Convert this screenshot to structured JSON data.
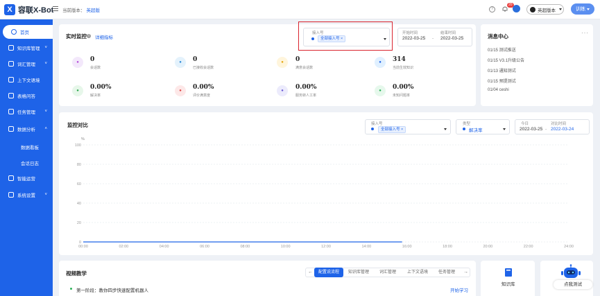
{
  "brand": {
    "name": "容联X-Bot",
    "mark": "X"
  },
  "header": {
    "version_label": "当前版本：",
    "version_name": "英超版",
    "bell_badge": "20",
    "version_select": "英超版本",
    "train_button": "训练"
  },
  "sidebar": {
    "items": [
      {
        "label": "首页",
        "icon": "home-icon",
        "active": true
      },
      {
        "label": "知识库管理",
        "icon": "book-icon",
        "chevron": "˅"
      },
      {
        "label": "词汇管理",
        "icon": "vocab-icon",
        "chevron": "˅"
      },
      {
        "label": "上下文语境",
        "icon": "context-icon"
      },
      {
        "label": "表格问答",
        "icon": "table-icon"
      },
      {
        "label": "任务管理",
        "icon": "task-icon",
        "chevron": "˅"
      },
      {
        "label": "数据分析",
        "icon": "chart-icon",
        "chevron": "˄"
      },
      {
        "label": "智能运营",
        "icon": "shield-icon"
      },
      {
        "label": "系统设置",
        "icon": "gear-icon",
        "chevron": "˅"
      }
    ],
    "subitems": [
      "数据看板",
      "会话日志"
    ]
  },
  "realtime": {
    "title": "实时监控",
    "info": "i",
    "detail_link": "详细指标",
    "access_label": "接入号",
    "access_tag": "全部接入号",
    "tag_close": "×",
    "start_label": "开始时间",
    "start_value": "2022-03-25",
    "end_label": "结束时间",
    "end_value": "2022-03-25",
    "range_sep": "-",
    "metrics": [
      {
        "value": "0",
        "label": "会话数",
        "icon": "pen-icon",
        "color": "#f3e8fb",
        "fg": "#b44ad8"
      },
      {
        "value": "0",
        "label": "已接收会话数",
        "icon": "chat-icon",
        "color": "#e4f2fc",
        "fg": "#2b8ad8"
      },
      {
        "value": "0",
        "label": "满意会话数",
        "icon": "note-icon",
        "color": "#fff5dc",
        "fg": "#e5a50a"
      },
      {
        "value": "314",
        "label": "当前生效知识",
        "icon": "layers-icon",
        "color": "#e0f0ff",
        "fg": "#1e63e8"
      },
      {
        "value": "0.00%",
        "label": "解决率",
        "icon": "link-icon",
        "color": "#e7f7ea",
        "fg": "#2fa84f"
      },
      {
        "value": "0.00%",
        "label": "评价满意度",
        "icon": "thumb-icon",
        "color": "#fde8e8",
        "fg": "#e04848"
      },
      {
        "value": "0.00%",
        "label": "服务转人工率",
        "icon": "person-icon",
        "color": "#ecebfc",
        "fg": "#6b5bd6"
      },
      {
        "value": "0.00%",
        "label": "未知问题率",
        "icon": "doc-icon",
        "color": "#e6f8ec",
        "fg": "#2fb35a"
      }
    ]
  },
  "messages": {
    "title": "消息中心",
    "more": "···",
    "items": [
      "01/15 测试推送",
      "01/15 V3.1升级公告",
      "01/13 通知测试",
      "01/15 预提测试",
      "01/04 ceshi"
    ]
  },
  "compare": {
    "title": "监控对比",
    "access_label": "接入号",
    "access_tag": "全部接入号",
    "type_label": "类型",
    "type_value": "解决率",
    "today_label": "今日",
    "today_value": "2022-03-25",
    "compare_label": "对比时间",
    "compare_value": "2022-03-24",
    "range_sep": "-"
  },
  "chart_data": {
    "type": "line",
    "title": "",
    "ylabel": "%",
    "xlabel": "",
    "ylim": [
      0,
      100
    ],
    "y_ticks": [
      "100",
      "80",
      "60",
      "40",
      "20",
      "0"
    ],
    "categories": [
      "00:00",
      "02:00",
      "04:00",
      "06:00",
      "08:00",
      "10:00",
      "12:00",
      "14:00",
      "16:00",
      "18:00",
      "20:00",
      "22:00",
      "24:00"
    ],
    "series": [
      {
        "values": [
          0,
          0,
          0,
          0,
          0,
          0,
          0,
          0,
          0,
          0,
          0,
          0,
          0
        ]
      }
    ],
    "grid": true
  },
  "video": {
    "title": "视频教学",
    "tabs": [
      "配置说流程",
      "知识库管理",
      "词汇管理",
      "上下文语境",
      "任务管理"
    ],
    "prev": "←",
    "next": "→",
    "stage": "第一阶段：教你四步快速配置机器人",
    "start_link": "开始学习"
  },
  "shortcuts": {
    "kb_label": "知识库",
    "test_label": "点我测试"
  }
}
